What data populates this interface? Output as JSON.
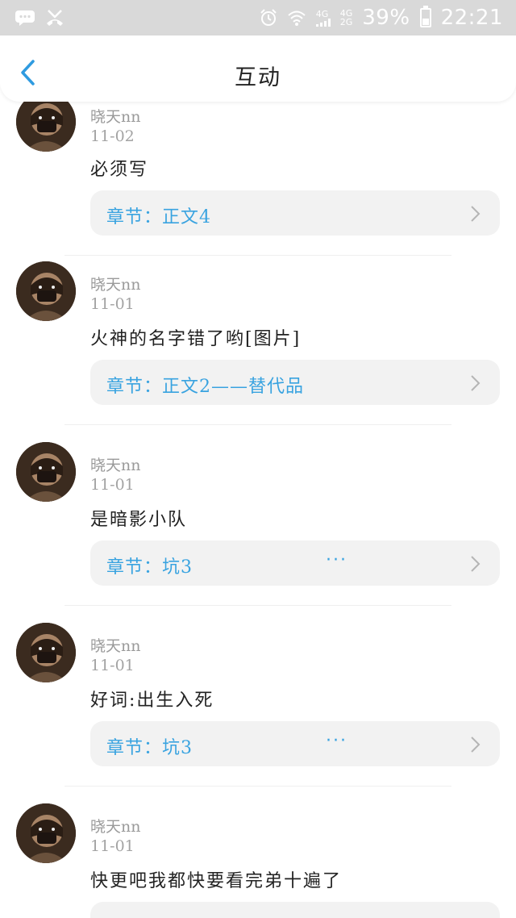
{
  "status_bar": {
    "signal_1": "4G",
    "signal_2_top": "4G",
    "signal_2_bottom": "2G",
    "battery": "39%",
    "time": "22:21",
    "icons": [
      "message-icon",
      "missed-call-icon",
      "alarm-icon",
      "wifi-icon",
      "signal-icon",
      "battery-icon"
    ]
  },
  "header": {
    "title": "互动",
    "back_icon": "chevron-left-icon"
  },
  "colors": {
    "accent": "#39a3e0",
    "chapter_bg": "#f2f2f2",
    "status_bar_bg": "#d9d9d9"
  },
  "comments": [
    {
      "user": "晓天nn",
      "date": "11-02",
      "text": "必须写",
      "chapter": "章节：正文4",
      "has_more": false
    },
    {
      "user": "晓天nn",
      "date": "11-01",
      "text": "火神的名字错了哟[图片]",
      "chapter": "章节：正文2——替代品",
      "has_more": false
    },
    {
      "user": "晓天nn",
      "date": "11-01",
      "text": "是暗影小队",
      "chapter": "章节：坑3",
      "has_more": true,
      "more": "···"
    },
    {
      "user": "晓天nn",
      "date": "11-01",
      "text": "好词:出生入死",
      "chapter": "章节：坑3",
      "has_more": true,
      "more": "···"
    },
    {
      "user": "晓天nn",
      "date": "11-01",
      "text": "快更吧我都快要看完弟十遍了",
      "chapter": "",
      "has_more": false
    }
  ]
}
